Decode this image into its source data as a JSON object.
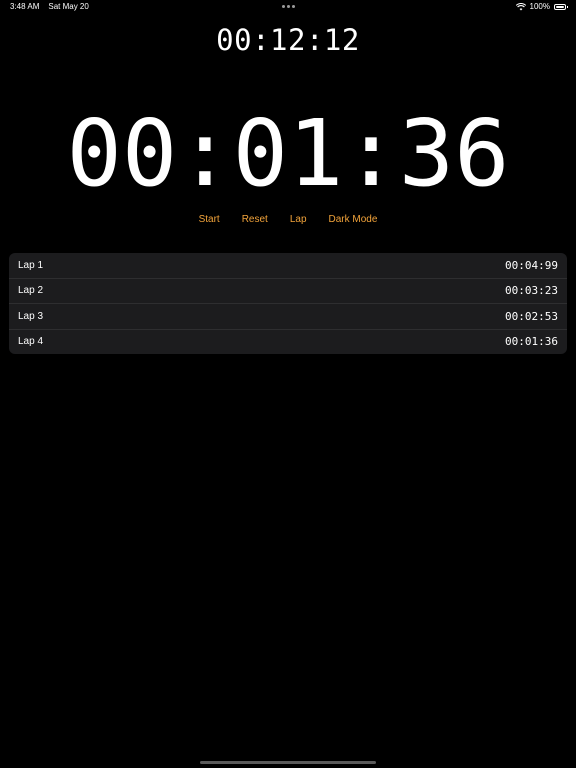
{
  "status_bar": {
    "time": "3:48 AM",
    "date": "Sat May 20",
    "battery": "100%",
    "battery_level": 1.0,
    "icons": [
      "wifi-icon",
      "battery-icon"
    ]
  },
  "total_time": "00:12:12",
  "current_time": "00:01:36",
  "controls": {
    "start_label": "Start",
    "reset_label": "Reset",
    "lap_label": "Lap",
    "dark_mode_label": "Dark Mode"
  },
  "laps": [
    {
      "label": "Lap 1",
      "time": "00:04:99"
    },
    {
      "label": "Lap 2",
      "time": "00:03:23"
    },
    {
      "label": "Lap 3",
      "time": "00:02:53"
    },
    {
      "label": "Lap 4",
      "time": "00:01:36"
    }
  ],
  "colors": {
    "background": "#000000",
    "accent": "#f2a33a",
    "list_background": "#1c1c1e"
  }
}
